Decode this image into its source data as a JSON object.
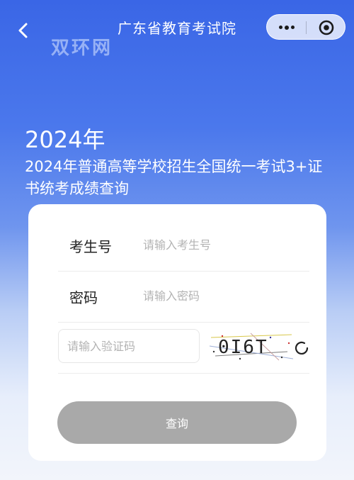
{
  "nav": {
    "title": "广东省教育考试院",
    "back_icon": "chevron-left-icon",
    "more_icon": "more-dots-icon",
    "close_icon": "target-circle-icon"
  },
  "watermark": "双环网",
  "header": {
    "year": "2024年",
    "subtitle": "2024年普通高等学校招生全国统一考试3+证书统考成绩查询"
  },
  "form": {
    "exam_no": {
      "label": "考生号",
      "placeholder": "请输入考生号",
      "value": ""
    },
    "password": {
      "label": "密码",
      "placeholder": "请输入密码",
      "value": ""
    },
    "captcha": {
      "placeholder": "请输入验证码",
      "value": "",
      "code": "0I6T",
      "refresh_icon": "refresh-icon"
    },
    "submit_label": "查询"
  },
  "colors": {
    "brand_blue": "#3a66e6",
    "button_disabled": "#a9a9a9",
    "card": "#ffffff"
  }
}
